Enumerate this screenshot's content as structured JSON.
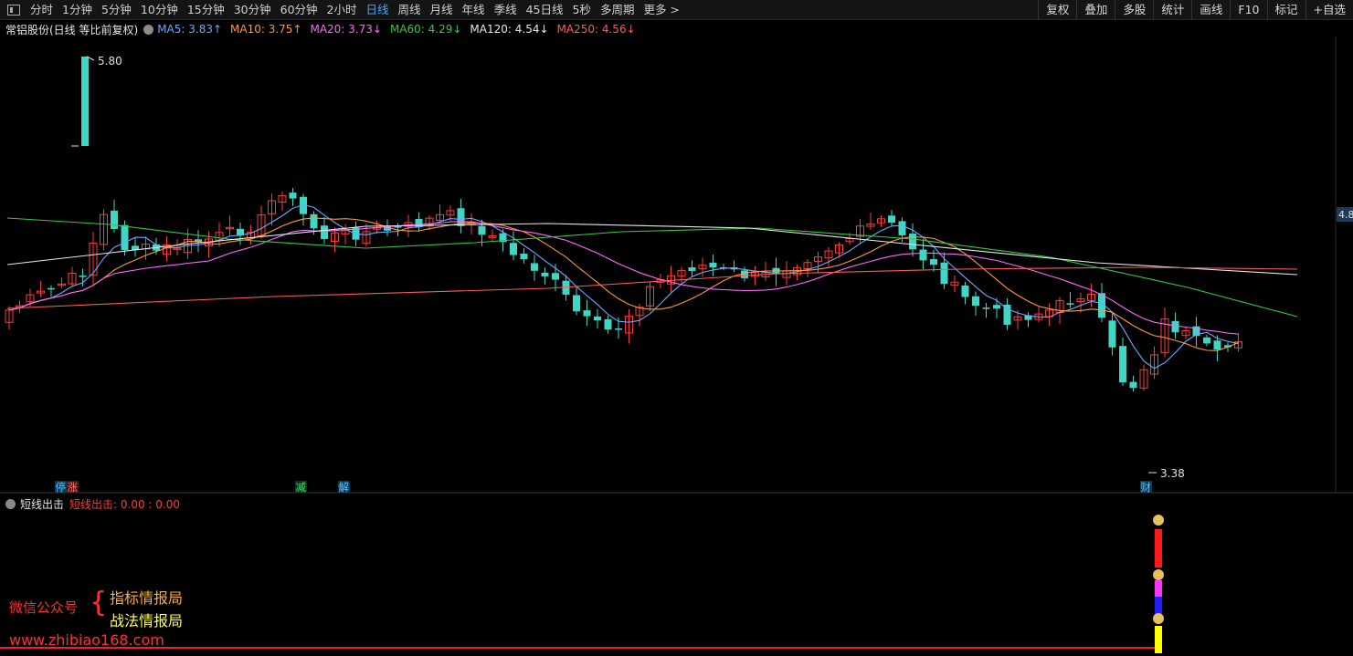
{
  "toolbar": {
    "periods": [
      "分时",
      "1分钟",
      "5分钟",
      "10分钟",
      "15分钟",
      "30分钟",
      "60分钟",
      "2小时",
      "日线",
      "周线",
      "月线",
      "年线",
      "季线",
      "45日线",
      "5秒",
      "多周期",
      "更多 >"
    ],
    "active_period": "日线",
    "right_tools": [
      "复权",
      "叠加",
      "多股",
      "统计",
      "画线",
      "F10",
      "标记",
      "+自选"
    ]
  },
  "info": {
    "title": "常铝股份(日线 等比前复权)",
    "ma": [
      {
        "label": "MA5: 3.83↑",
        "color": "#6aa9ff"
      },
      {
        "label": "MA10: 3.75↑",
        "color": "#ff9a2e"
      },
      {
        "label": "MA20: 3.73↓",
        "color": "#ff66ff"
      },
      {
        "label": "MA60: 4.29↓",
        "color": "#2ecc40"
      },
      {
        "label": "MA120: 4.54↓",
        "color": "#e8e8e8"
      },
      {
        "label": "MA250: 4.56↓",
        "color": "#ff5a5a"
      }
    ]
  },
  "chart": {
    "high_label": "5.80",
    "low_label": "3.38",
    "right_axis_label": "4.8",
    "event_tags": [
      "停",
      "涨",
      "减",
      "解",
      "财"
    ],
    "colors": {
      "up": "#ff3b3b",
      "down": "#3fd6c6",
      "ma5": "#6aa9ff",
      "ma10": "#ff9a2e",
      "ma20": "#ff66ff",
      "ma60": "#2ecc40",
      "ma120": "#e8e8e8",
      "ma250": "#ff5a5a"
    }
  },
  "sub": {
    "name": "短线出击",
    "value_label": "短线出击: 0.00 : 0.00"
  },
  "watermark": {
    "left": "微信公众号",
    "r1": "指标情报局",
    "r2": "战法情报局",
    "url": "www.zhibiao168.com"
  }
}
